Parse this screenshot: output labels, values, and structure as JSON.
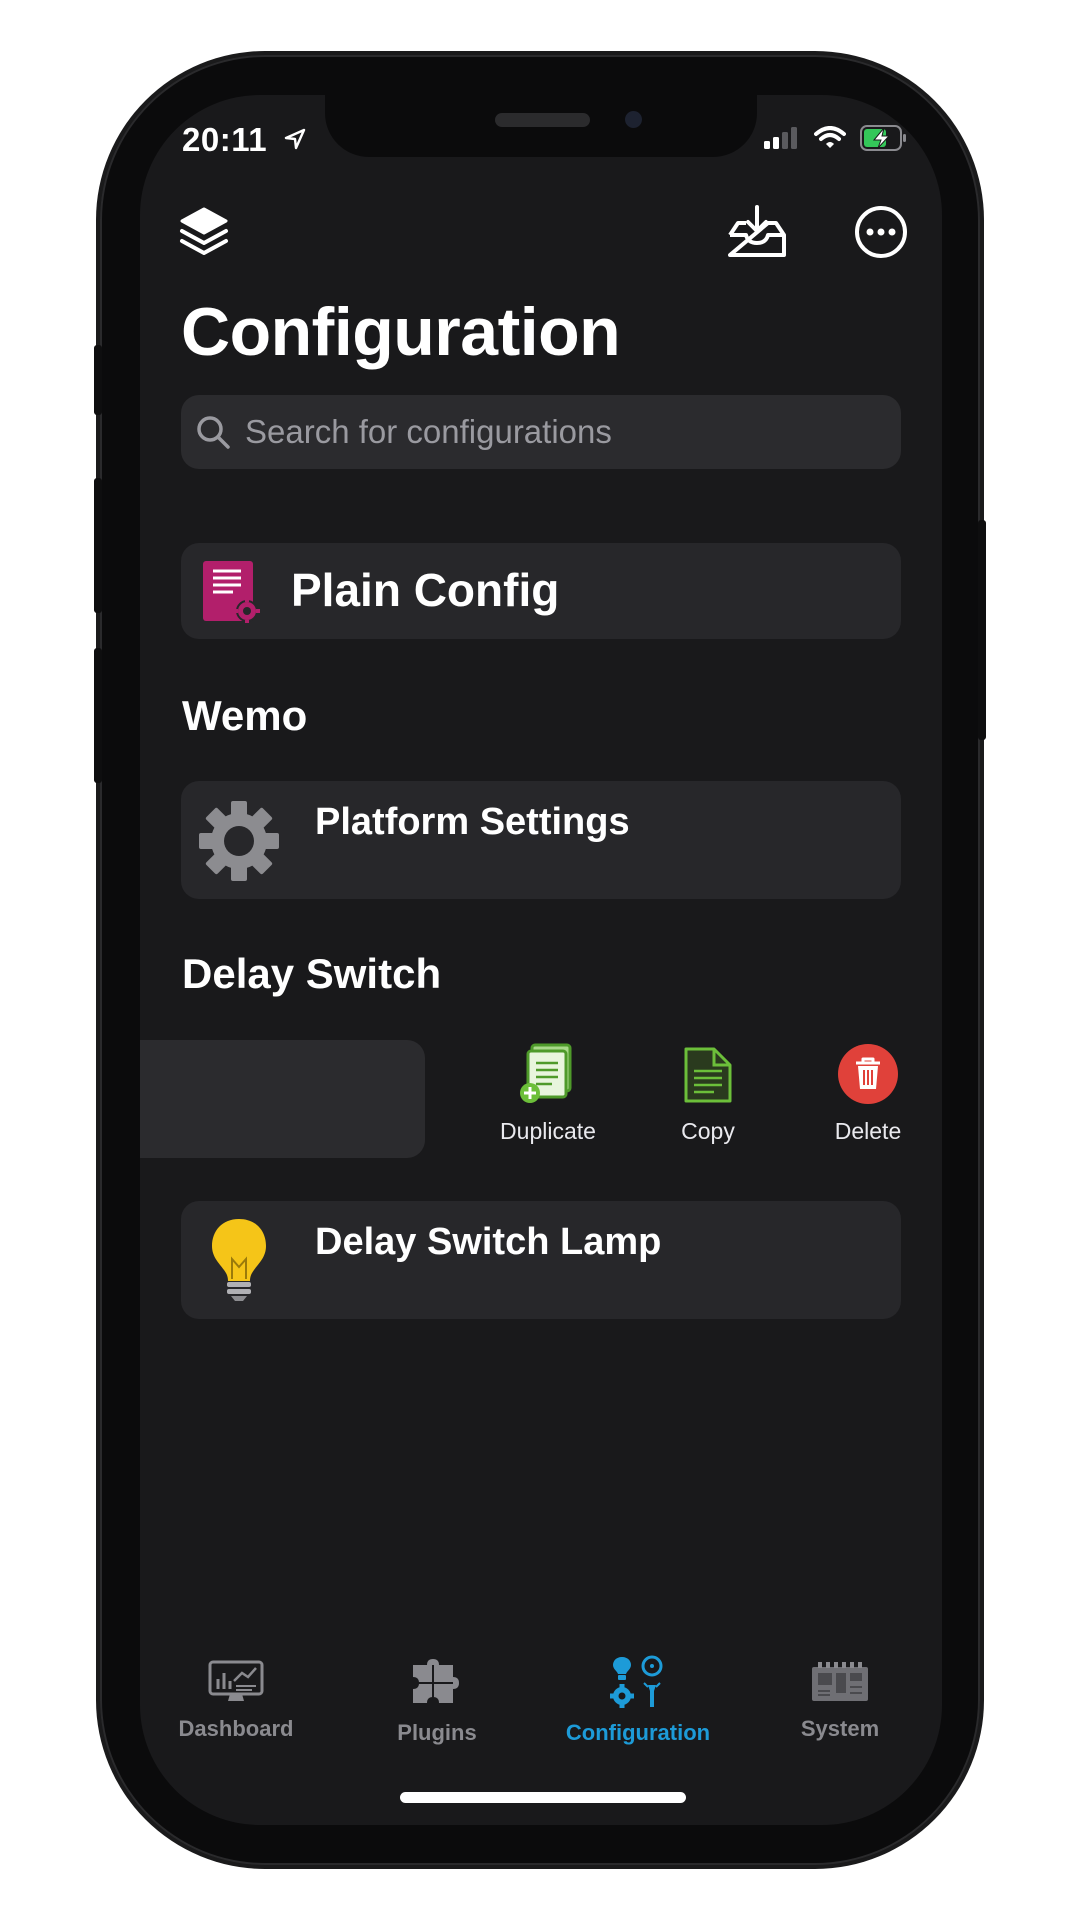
{
  "status_bar": {
    "time": "20:11"
  },
  "header": {
    "title": "Configuration"
  },
  "search": {
    "placeholder": "Search for configurations"
  },
  "plain_config": {
    "label": "Plain Config"
  },
  "sections": [
    {
      "title": "Wemo",
      "rows": [
        {
          "label": "Platform Settings",
          "icon": "gear-icon"
        }
      ]
    },
    {
      "title": "Delay Switch",
      "rows": [
        {
          "label": "Delay Switch Lamp",
          "icon": "lightbulb-icon"
        }
      ]
    }
  ],
  "swipe_actions": [
    {
      "label": "Duplicate",
      "icon": "duplicate-document-icon"
    },
    {
      "label": "Copy",
      "icon": "copy-document-icon"
    },
    {
      "label": "Delete",
      "icon": "trash-icon"
    }
  ],
  "tabs": [
    {
      "label": "Dashboard",
      "icon": "dashboard-icon",
      "active": false
    },
    {
      "label": "Plugins",
      "icon": "puzzle-icon",
      "active": false
    },
    {
      "label": "Configuration",
      "icon": "configuration-icon",
      "active": true
    },
    {
      "label": "System",
      "icon": "circuit-board-icon",
      "active": false
    }
  ],
  "colors": {
    "background": "#19191b",
    "card": "#27272a",
    "accent": "#1d9bd8",
    "tab_inactive": "#8a8a8f",
    "delete_red": "#e0413a",
    "copy_green": "#6cbf3a",
    "plain_config_pink": "#b21f6b",
    "bulb_yellow": "#f5c518"
  }
}
